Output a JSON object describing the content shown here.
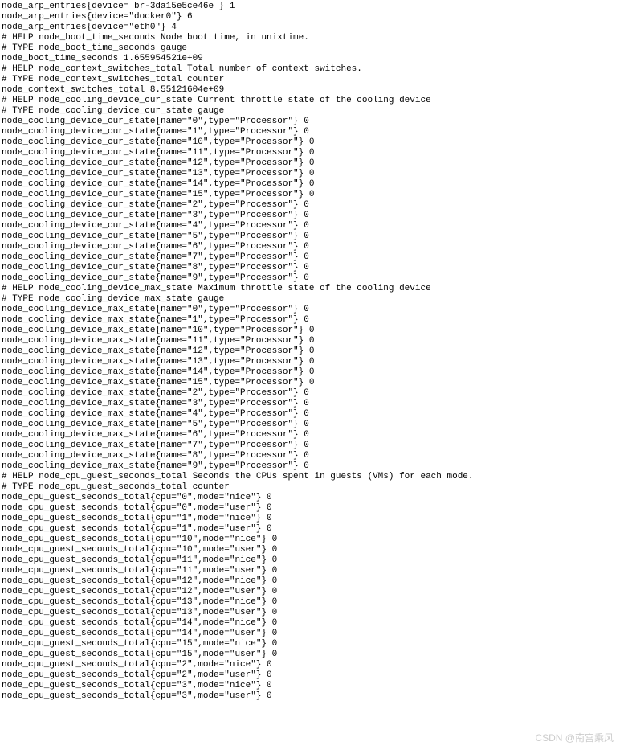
{
  "lines": [
    "node_arp_entries{device= br-3da15e5ce46e } 1",
    "node_arp_entries{device=\"docker0\"} 6",
    "node_arp_entries{device=\"eth0\"} 4",
    "# HELP node_boot_time_seconds Node boot time, in unixtime.",
    "# TYPE node_boot_time_seconds gauge",
    "node_boot_time_seconds 1.655954521e+09",
    "# HELP node_context_switches_total Total number of context switches.",
    "# TYPE node_context_switches_total counter",
    "node_context_switches_total 8.55121604e+09",
    "# HELP node_cooling_device_cur_state Current throttle state of the cooling device",
    "# TYPE node_cooling_device_cur_state gauge",
    "node_cooling_device_cur_state{name=\"0\",type=\"Processor\"} 0",
    "node_cooling_device_cur_state{name=\"1\",type=\"Processor\"} 0",
    "node_cooling_device_cur_state{name=\"10\",type=\"Processor\"} 0",
    "node_cooling_device_cur_state{name=\"11\",type=\"Processor\"} 0",
    "node_cooling_device_cur_state{name=\"12\",type=\"Processor\"} 0",
    "node_cooling_device_cur_state{name=\"13\",type=\"Processor\"} 0",
    "node_cooling_device_cur_state{name=\"14\",type=\"Processor\"} 0",
    "node_cooling_device_cur_state{name=\"15\",type=\"Processor\"} 0",
    "node_cooling_device_cur_state{name=\"2\",type=\"Processor\"} 0",
    "node_cooling_device_cur_state{name=\"3\",type=\"Processor\"} 0",
    "node_cooling_device_cur_state{name=\"4\",type=\"Processor\"} 0",
    "node_cooling_device_cur_state{name=\"5\",type=\"Processor\"} 0",
    "node_cooling_device_cur_state{name=\"6\",type=\"Processor\"} 0",
    "node_cooling_device_cur_state{name=\"7\",type=\"Processor\"} 0",
    "node_cooling_device_cur_state{name=\"8\",type=\"Processor\"} 0",
    "node_cooling_device_cur_state{name=\"9\",type=\"Processor\"} 0",
    "# HELP node_cooling_device_max_state Maximum throttle state of the cooling device",
    "# TYPE node_cooling_device_max_state gauge",
    "node_cooling_device_max_state{name=\"0\",type=\"Processor\"} 0",
    "node_cooling_device_max_state{name=\"1\",type=\"Processor\"} 0",
    "node_cooling_device_max_state{name=\"10\",type=\"Processor\"} 0",
    "node_cooling_device_max_state{name=\"11\",type=\"Processor\"} 0",
    "node_cooling_device_max_state{name=\"12\",type=\"Processor\"} 0",
    "node_cooling_device_max_state{name=\"13\",type=\"Processor\"} 0",
    "node_cooling_device_max_state{name=\"14\",type=\"Processor\"} 0",
    "node_cooling_device_max_state{name=\"15\",type=\"Processor\"} 0",
    "node_cooling_device_max_state{name=\"2\",type=\"Processor\"} 0",
    "node_cooling_device_max_state{name=\"3\",type=\"Processor\"} 0",
    "node_cooling_device_max_state{name=\"4\",type=\"Processor\"} 0",
    "node_cooling_device_max_state{name=\"5\",type=\"Processor\"} 0",
    "node_cooling_device_max_state{name=\"6\",type=\"Processor\"} 0",
    "node_cooling_device_max_state{name=\"7\",type=\"Processor\"} 0",
    "node_cooling_device_max_state{name=\"8\",type=\"Processor\"} 0",
    "node_cooling_device_max_state{name=\"9\",type=\"Processor\"} 0",
    "# HELP node_cpu_guest_seconds_total Seconds the CPUs spent in guests (VMs) for each mode.",
    "# TYPE node_cpu_guest_seconds_total counter",
    "node_cpu_guest_seconds_total{cpu=\"0\",mode=\"nice\"} 0",
    "node_cpu_guest_seconds_total{cpu=\"0\",mode=\"user\"} 0",
    "node_cpu_guest_seconds_total{cpu=\"1\",mode=\"nice\"} 0",
    "node_cpu_guest_seconds_total{cpu=\"1\",mode=\"user\"} 0",
    "node_cpu_guest_seconds_total{cpu=\"10\",mode=\"nice\"} 0",
    "node_cpu_guest_seconds_total{cpu=\"10\",mode=\"user\"} 0",
    "node_cpu_guest_seconds_total{cpu=\"11\",mode=\"nice\"} 0",
    "node_cpu_guest_seconds_total{cpu=\"11\",mode=\"user\"} 0",
    "node_cpu_guest_seconds_total{cpu=\"12\",mode=\"nice\"} 0",
    "node_cpu_guest_seconds_total{cpu=\"12\",mode=\"user\"} 0",
    "node_cpu_guest_seconds_total{cpu=\"13\",mode=\"nice\"} 0",
    "node_cpu_guest_seconds_total{cpu=\"13\",mode=\"user\"} 0",
    "node_cpu_guest_seconds_total{cpu=\"14\",mode=\"nice\"} 0",
    "node_cpu_guest_seconds_total{cpu=\"14\",mode=\"user\"} 0",
    "node_cpu_guest_seconds_total{cpu=\"15\",mode=\"nice\"} 0",
    "node_cpu_guest_seconds_total{cpu=\"15\",mode=\"user\"} 0",
    "node_cpu_guest_seconds_total{cpu=\"2\",mode=\"nice\"} 0",
    "node_cpu_guest_seconds_total{cpu=\"2\",mode=\"user\"} 0",
    "node_cpu_guest_seconds_total{cpu=\"3\",mode=\"nice\"} 0",
    "node_cpu_guest_seconds_total{cpu=\"3\",mode=\"user\"} 0"
  ],
  "watermark": "CSDN @南宫乘风"
}
